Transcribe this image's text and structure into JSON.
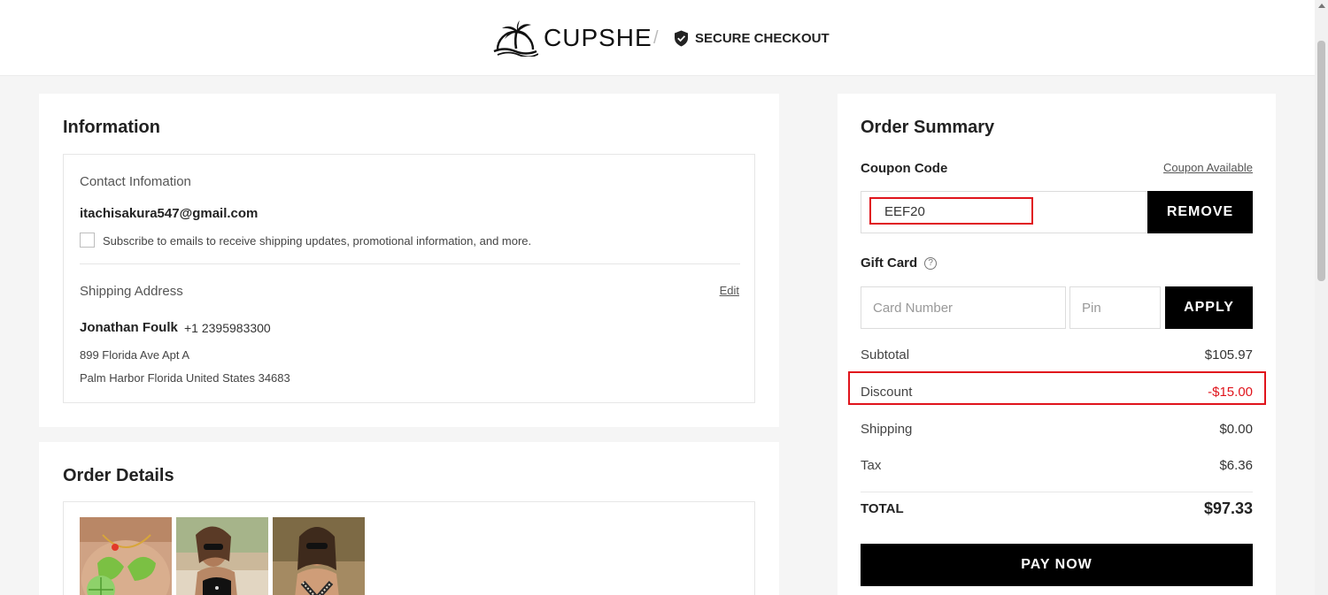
{
  "header": {
    "brand": "CUPSHE",
    "separator": "/",
    "secure_label": "SECURE CHECKOUT"
  },
  "information": {
    "title": "Information",
    "contact_label": "Contact Infomation",
    "email": "itachisakura547@gmail.com",
    "subscribe_text": "Subscribe to emails to receive shipping updates, promotional information, and more.",
    "subscribe_checked": false,
    "shipping_label": "Shipping Address",
    "edit_label": "Edit",
    "name": "Jonathan Foulk",
    "phone": "+1 2395983300",
    "address_line1": "899 Florida Ave Apt A",
    "address_line2": "Palm Harbor Florida United States 34683"
  },
  "order_details": {
    "title": "Order Details",
    "items": [
      "product-thumbnail-1",
      "product-thumbnail-2",
      "product-thumbnail-3"
    ]
  },
  "summary": {
    "title": "Order Summary",
    "coupon_label": "Coupon Code",
    "coupon_available": "Coupon Available",
    "coupon_value": "EEF20",
    "remove_label": "REMOVE",
    "gift_card_label": "Gift Card",
    "help_icon": "?",
    "card_number_placeholder": "Card Number",
    "pin_placeholder": "Pin",
    "apply_label": "APPLY",
    "subtotal_label": "Subtotal",
    "subtotal_value": "$105.97",
    "discount_label": "Discount",
    "discount_value": "-$15.00",
    "shipping_label": "Shipping",
    "shipping_value": "$0.00",
    "tax_label": "Tax",
    "tax_value": "$6.36",
    "total_label": "TOTAL",
    "total_value": "$97.33",
    "pay_label": "PAY NOW"
  },
  "colors": {
    "accent_red": "#e0141c",
    "button_black": "#000000",
    "background": "#f5f5f5"
  }
}
